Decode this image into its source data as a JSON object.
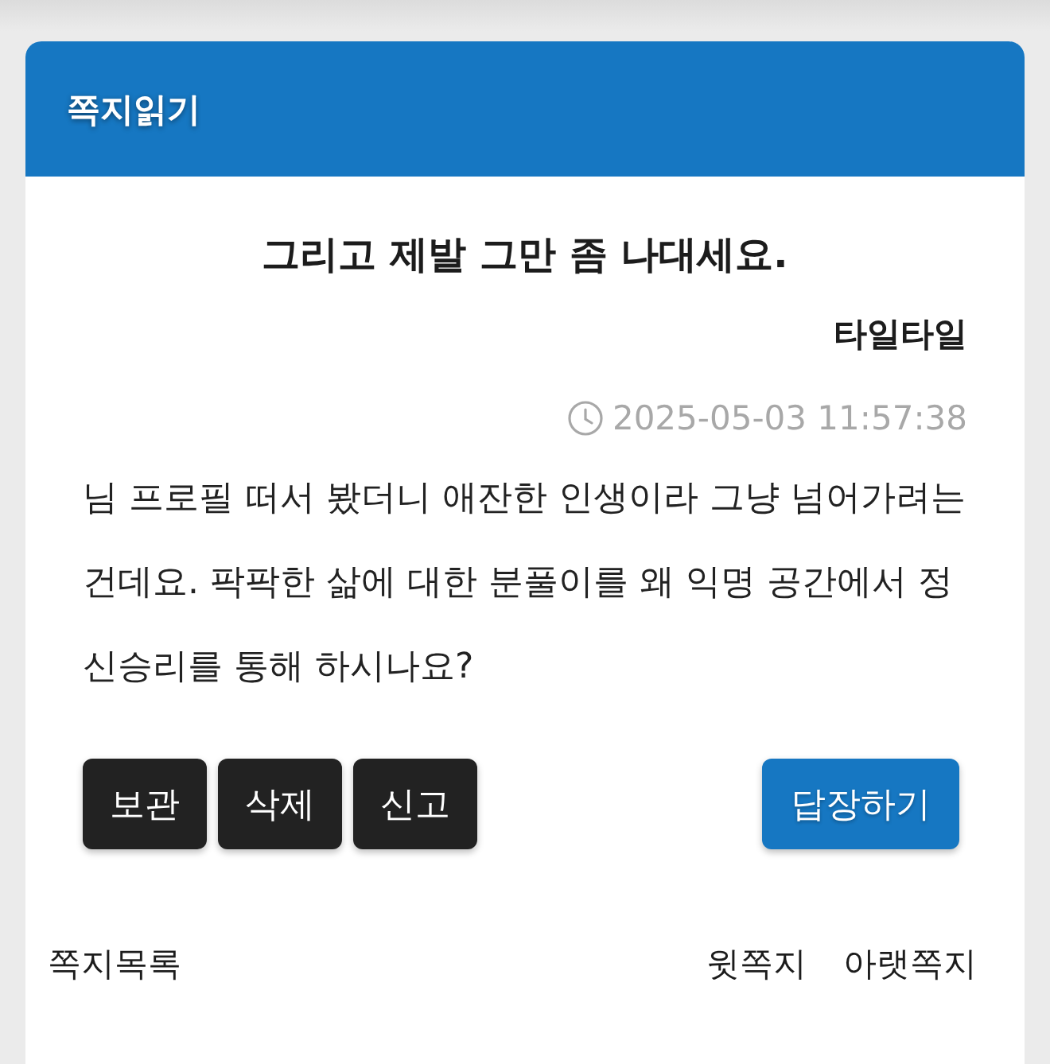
{
  "header": {
    "title": "쪽지읽기"
  },
  "message": {
    "subject": "그리고 제발 그만 좀 나대세요.",
    "sender": "타일타일",
    "timestamp": "2025-05-03 11:57:38",
    "body": "님 프로필 떠서 봤더니 애잔한 인생이라 그냥 넘어가려는 건데요. 팍팍한 삶에 대한 분풀이를 왜 익명 공간에서 정신승리를 통해 하시나요?"
  },
  "actions": [
    {
      "label": "보관",
      "kind": "dark"
    },
    {
      "label": "삭제",
      "kind": "dark"
    },
    {
      "label": "신고",
      "kind": "dark"
    },
    {
      "label": "답장하기",
      "kind": "primary"
    }
  ],
  "footer": {
    "list_link": "쪽지목록",
    "nav_links": [
      "윗쪽지",
      "아랫쪽지"
    ]
  }
}
